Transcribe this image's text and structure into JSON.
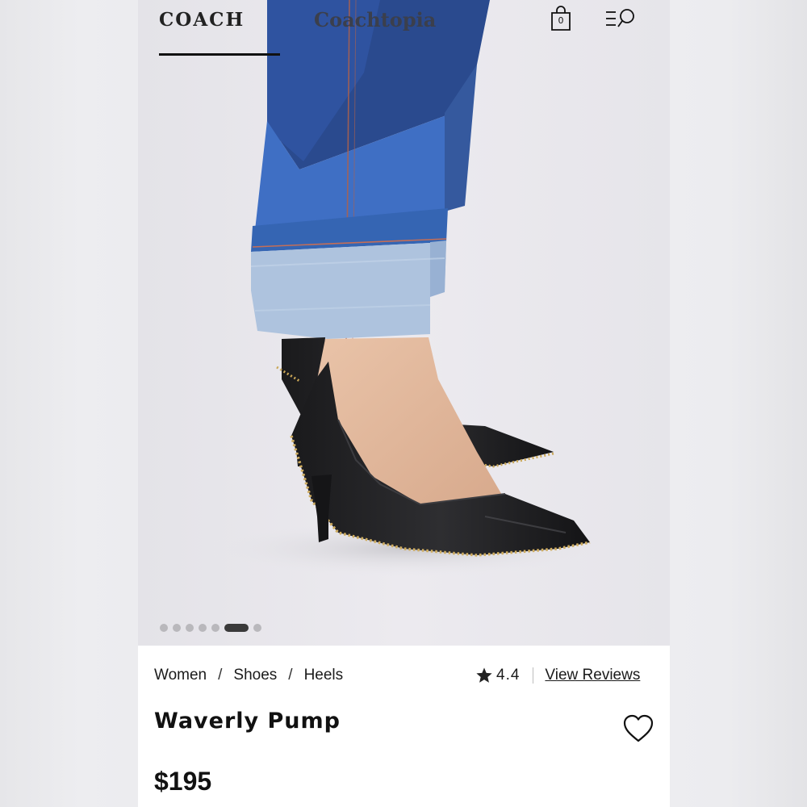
{
  "header": {
    "tabs": [
      {
        "label": "COACH",
        "active": true
      },
      {
        "label": "Coachtopia",
        "active": false
      }
    ],
    "bag_count": "0",
    "icons": [
      "shopping-bag-icon",
      "menu-search-icon"
    ]
  },
  "gallery": {
    "image": "black leather pointed-toe pump with studded trim worn with cuffed patchwork denim",
    "dot_count": 7,
    "active_index": 5
  },
  "product": {
    "breadcrumb": [
      "Women",
      "Shoes",
      "Heels"
    ],
    "breadcrumb_separator": "/",
    "rating": "4.4",
    "view_reviews_label": "View Reviews",
    "title": "Waverly Pump",
    "price": "$195"
  },
  "colors": {
    "text": "#111111",
    "background": "#ffffff",
    "dot_active": "#3a3a3a",
    "dot_inactive": "#b9b8bc"
  }
}
